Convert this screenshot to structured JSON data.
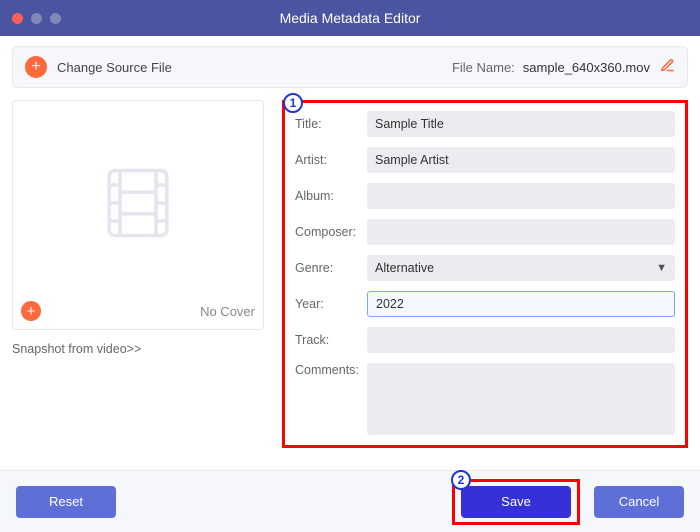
{
  "window": {
    "title": "Media Metadata Editor"
  },
  "topbar": {
    "change_source": "Change Source File",
    "file_label": "File Name:",
    "file_name": "sample_640x360.mov"
  },
  "cover": {
    "no_cover": "No Cover",
    "snapshot": "Snapshot from video>>"
  },
  "form": {
    "title_label": "Title:",
    "title_value": "Sample Title",
    "artist_label": "Artist:",
    "artist_value": "Sample Artist",
    "album_label": "Album:",
    "album_value": "",
    "composer_label": "Composer:",
    "composer_value": "",
    "genre_label": "Genre:",
    "genre_value": "Alternative",
    "year_label": "Year:",
    "year_value": "2022",
    "track_label": "Track:",
    "track_value": "",
    "comments_label": "Comments:",
    "comments_value": ""
  },
  "footer": {
    "reset": "Reset",
    "save": "Save",
    "cancel": "Cancel"
  },
  "callouts": {
    "one": "1",
    "two": "2"
  }
}
